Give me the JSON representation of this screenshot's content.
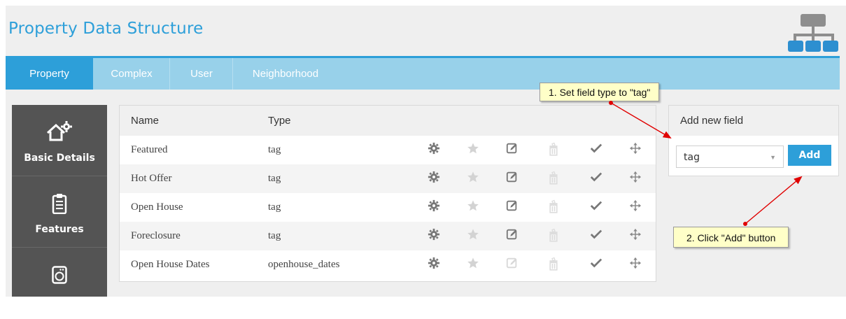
{
  "page": {
    "title": "Property Data Structure"
  },
  "tabs": [
    {
      "label": "Property",
      "active": true
    },
    {
      "label": "Complex",
      "active": false
    },
    {
      "label": "User",
      "active": false
    },
    {
      "label": "Neighborhood",
      "active": false
    }
  ],
  "sidebar": {
    "items": [
      {
        "label": "Basic Details",
        "icon": "house-gear-icon"
      },
      {
        "label": "Features",
        "icon": "clipboard-icon"
      },
      {
        "label": "",
        "icon": "washing-machine-icon"
      }
    ]
  },
  "table": {
    "headers": {
      "name": "Name",
      "type": "Type"
    },
    "rows": [
      {
        "name": "Featured",
        "type": "tag",
        "edit_enabled": true
      },
      {
        "name": "Hot Offer",
        "type": "tag",
        "edit_enabled": true
      },
      {
        "name": "Open House",
        "type": "tag",
        "edit_enabled": true
      },
      {
        "name": "Foreclosure",
        "type": "tag",
        "edit_enabled": true
      },
      {
        "name": "Open House Dates",
        "type": "openhouse_dates",
        "edit_enabled": false
      }
    ],
    "actions": [
      "settings-gear-icon",
      "star-icon",
      "edit-icon",
      "trash-icon",
      "check-icon",
      "move-icon"
    ]
  },
  "add_field": {
    "title": "Add new field",
    "selected_type": "tag",
    "button_label": "Add"
  },
  "annotations": {
    "step1": "1. Set field type to \"tag\"",
    "step2": "2. Click \"Add\" button"
  },
  "colors": {
    "accent": "#2d9fd9",
    "tabbar": "#98d1ea",
    "sidebar": "#545454",
    "callout": "#ffffc8",
    "arrow": "#e00000"
  }
}
